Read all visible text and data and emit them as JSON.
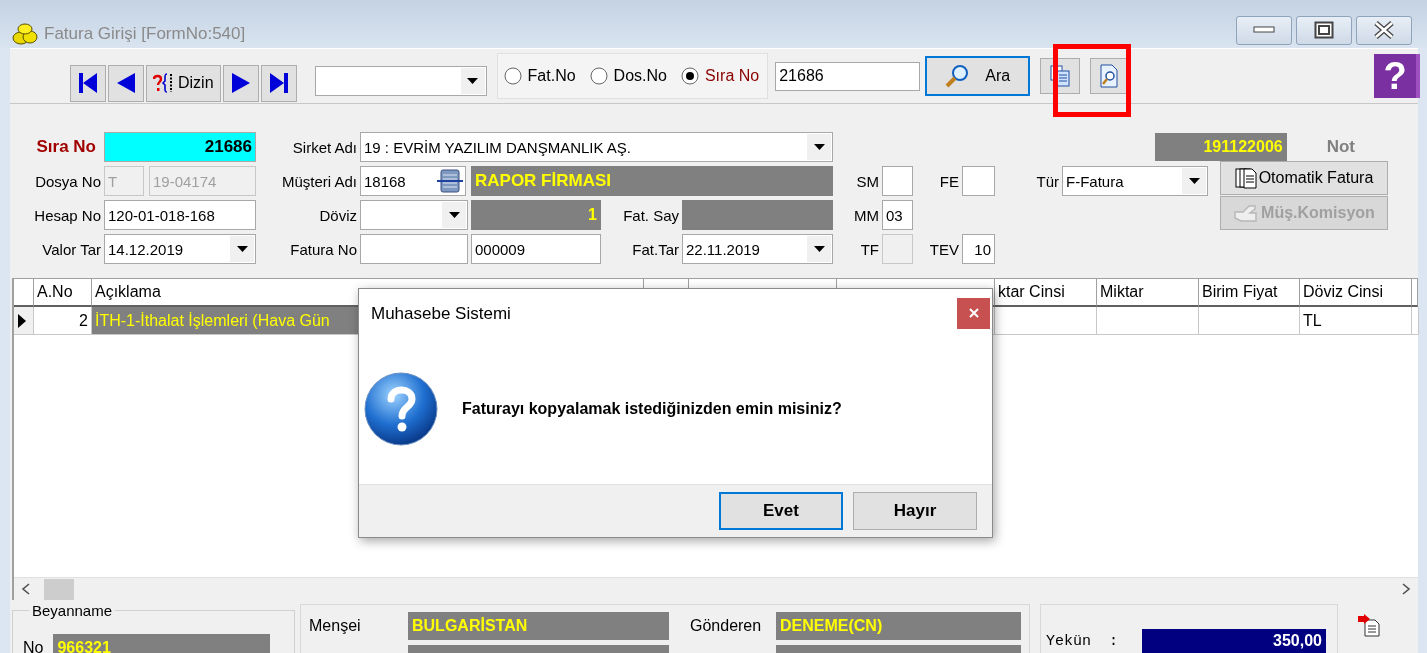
{
  "window": {
    "title": "Fatura Girişi [FormNo:540]"
  },
  "toolbar": {
    "nav": [
      {
        "kind": "first"
      },
      {
        "kind": "prev"
      },
      {
        "kind": "index",
        "label": "Dizin"
      },
      {
        "kind": "next"
      },
      {
        "kind": "last"
      }
    ],
    "search_by": [
      {
        "label": "Fat.No",
        "selected": false
      },
      {
        "label": "Dos.No",
        "selected": false
      },
      {
        "label": "Sıra No",
        "selected": true
      }
    ],
    "search_value": "21686",
    "search_button": "Ara",
    "help": "?"
  },
  "form": {
    "sira_no": {
      "label": "Sıra No",
      "value": "21686"
    },
    "sirket_adi": {
      "label": "Sirket Adı",
      "value": "19 : EVRİM YAZILIM DANŞMANLIK AŞ."
    },
    "code": "191122006",
    "note": "Not",
    "dosya_no": {
      "label": "Dosya No",
      "prefix": "T",
      "value": "19-04174",
      "disabled": true
    },
    "musteri_adi": {
      "label": "Müşteri Adı",
      "code": "18168",
      "name": "RAPOR FİRMASI"
    },
    "sm": {
      "label": "SM"
    },
    "fe": {
      "label": "FE"
    },
    "tur": {
      "label": "Tür",
      "value": "F-Fatura"
    },
    "hesap_no": {
      "label": "Hesap No",
      "value": "120-01-018-168"
    },
    "doviz": {
      "label": "Döviz",
      "rate": "1"
    },
    "fat_say": {
      "label": "Fat. Say"
    },
    "mm": {
      "label": "MM",
      "value": "03"
    },
    "valor_tar": {
      "label": "Valor Tar",
      "value": "14.12.2019"
    },
    "fatura_no": {
      "label": "Fatura No",
      "number": "000009"
    },
    "fat_tar": {
      "label": "Fat.Tar",
      "value": "22.11.2019"
    },
    "tf": {
      "label": "TF",
      "disabled": true
    },
    "tev": {
      "label": "TEV",
      "value": "10"
    },
    "buttons": [
      {
        "label": "Otomatik Fatura",
        "disabled": false
      },
      {
        "label": "Müş.Komisyon",
        "disabled": true
      }
    ]
  },
  "table": {
    "columns": [
      "A.No",
      "Açıklama",
      "ktar Cinsi",
      "Miktar",
      "Birim Fiyat",
      "Döviz Cinsi"
    ],
    "rows": [
      {
        "selected": true,
        "a_no": "2",
        "aciklama": "İTH-1-İthalat İşlemleri  (Hava Gün",
        "doviz_cinsi": "TL"
      }
    ]
  },
  "footer": {
    "beyanname": {
      "title": "Beyanname",
      "no_label": "No",
      "no_value": "966321"
    },
    "mensei": {
      "label": "Menşei",
      "value": "BULGARİSTAN"
    },
    "gonderen": {
      "label": "Gönderen",
      "value": "DENEME(CN)"
    },
    "yekun": {
      "label": "Yekün  :",
      "value": "350,00"
    }
  },
  "dialog": {
    "title": "Muhasebe Sistemi",
    "message": "Faturayı kopyalamak istediğinizden emin misiniz?",
    "buttons": [
      {
        "label": "Evet",
        "focused": true
      },
      {
        "label": "Hayır",
        "focused": false
      }
    ]
  }
}
